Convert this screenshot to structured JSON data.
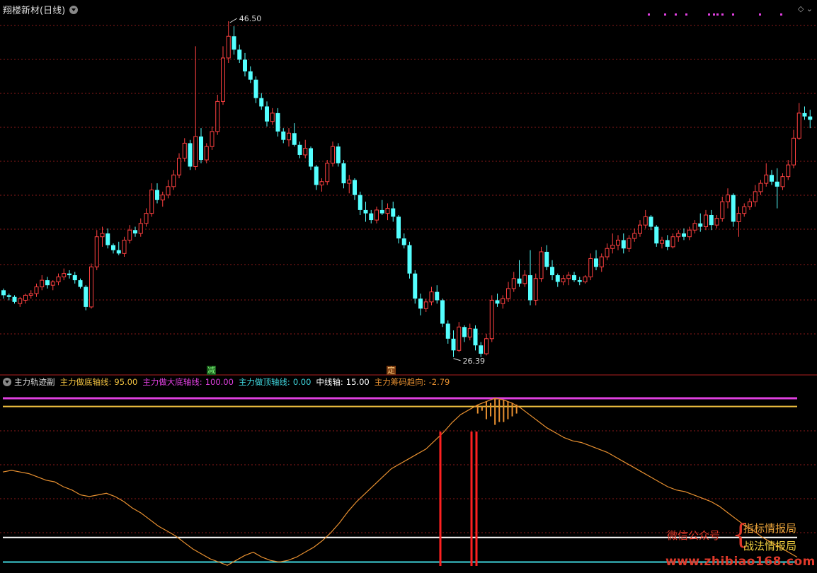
{
  "header": {
    "title": "翔楼新材(日线)"
  },
  "indicator": {
    "name": "主力轨迹副",
    "items": [
      {
        "label": "主力做底轴线:",
        "value": "95.00",
        "color": "#f0c040"
      },
      {
        "label": "主力做大底轴线:",
        "value": "100.00",
        "color": "#e040e0"
      },
      {
        "label": "主力做顶轴线:",
        "value": "0.00",
        "color": "#40d8e0"
      },
      {
        "label": "中线轴:",
        "value": "15.00",
        "color": "#ffffff"
      },
      {
        "label": "主力筹码趋向:",
        "value": "-2.79",
        "color": "#e89030"
      }
    ]
  },
  "markers": {
    "high_label": "46.50",
    "low_label": "26.39",
    "tag_reduce": "减",
    "tag_fix": "定"
  },
  "watermark": {
    "wechat": "微信公众号",
    "brace": "{",
    "brand1": "指标情报局",
    "brand2": "战法情报局",
    "url": "www.zhibiao168.com"
  },
  "colors": {
    "up": "#ff4040",
    "down": "#54ffff",
    "grid": "#8b1a1a",
    "magenta": "#e040e0",
    "gold": "#f0c040",
    "white": "#ffffff",
    "cyan": "#40d8e0",
    "orange": "#e89030",
    "red_bar": "#ff2020"
  },
  "chart_data": [
    {
      "type": "candlestick",
      "title": "翔楼新材(日线)",
      "ylim": [
        26.39,
        46.5
      ],
      "annotations": [
        {
          "label": "46.50",
          "kind": "high"
        },
        {
          "label": "26.39",
          "kind": "low"
        }
      ],
      "series": [
        {
          "values": [
            [
              30.4,
              30.5,
              29.9,
              30.1
            ],
            [
              30.1,
              30.2,
              29.8,
              30.0
            ],
            [
              30.0,
              30.1,
              29.6,
              29.7
            ],
            [
              29.6,
              30.0,
              29.4,
              29.9
            ],
            [
              29.8,
              30.2,
              29.6,
              30.1
            ],
            [
              30.1,
              30.4,
              29.9,
              30.2
            ],
            [
              30.2,
              30.8,
              30.0,
              30.6
            ],
            [
              30.6,
              31.3,
              30.4,
              31.0
            ],
            [
              31.0,
              31.2,
              30.5,
              30.7
            ],
            [
              30.7,
              31.0,
              30.4,
              30.9
            ],
            [
              30.9,
              31.4,
              30.7,
              31.2
            ],
            [
              31.2,
              31.7,
              31.0,
              31.4
            ],
            [
              31.4,
              31.6,
              31.1,
              31.3
            ],
            [
              31.3,
              31.5,
              30.8,
              31.0
            ],
            [
              31.0,
              31.1,
              30.5,
              30.6
            ],
            [
              30.6,
              30.7,
              29.2,
              29.4
            ],
            [
              29.4,
              32.0,
              29.3,
              31.8
            ],
            [
              31.8,
              34.0,
              31.6,
              33.6
            ],
            [
              33.6,
              34.2,
              33.0,
              33.8
            ],
            [
              33.8,
              34.1,
              32.9,
              33.1
            ],
            [
              33.1,
              33.2,
              32.6,
              32.8
            ],
            [
              32.8,
              33.3,
              32.5,
              32.6
            ],
            [
              32.6,
              33.6,
              32.4,
              33.4
            ],
            [
              33.4,
              34.3,
              33.2,
              34.0
            ],
            [
              34.0,
              34.2,
              33.6,
              33.8
            ],
            [
              33.8,
              34.7,
              33.6,
              34.4
            ],
            [
              34.4,
              35.3,
              34.2,
              35.0
            ],
            [
              35.0,
              36.8,
              34.8,
              36.4
            ],
            [
              36.4,
              36.8,
              35.6,
              35.8
            ],
            [
              35.8,
              36.3,
              35.4,
              36.1
            ],
            [
              36.1,
              37.0,
              35.9,
              36.6
            ],
            [
              36.6,
              37.6,
              36.4,
              37.3
            ],
            [
              37.3,
              38.6,
              37.1,
              38.3
            ],
            [
              38.3,
              39.5,
              38.1,
              39.2
            ],
            [
              39.2,
              39.4,
              37.6,
              37.8
            ],
            [
              37.8,
              45.0,
              37.6,
              39.6
            ],
            [
              39.6,
              40.1,
              38.0,
              38.2
            ],
            [
              38.2,
              39.2,
              38.0,
              39.0
            ],
            [
              39.0,
              40.2,
              38.8,
              39.9
            ],
            [
              39.9,
              42.1,
              39.7,
              41.7
            ],
            [
              41.7,
              45.0,
              41.5,
              44.3
            ],
            [
              44.3,
              46.5,
              44.0,
              45.6
            ],
            [
              45.6,
              46.2,
              44.5,
              44.8
            ],
            [
              44.8,
              45.1,
              44.0,
              44.2
            ],
            [
              44.2,
              44.6,
              43.2,
              43.5
            ],
            [
              43.5,
              43.8,
              42.8,
              43.0
            ],
            [
              43.0,
              43.2,
              41.6,
              41.9
            ],
            [
              41.9,
              42.2,
              41.2,
              41.4
            ],
            [
              41.4,
              41.7,
              40.2,
              40.5
            ],
            [
              40.5,
              41.3,
              40.3,
              41.0
            ],
            [
              41.0,
              41.3,
              39.6,
              39.9
            ],
            [
              39.9,
              40.1,
              39.2,
              39.4
            ],
            [
              39.4,
              40.1,
              39.0,
              39.8
            ],
            [
              39.8,
              40.4,
              39.0,
              39.1
            ],
            [
              39.1,
              39.3,
              38.3,
              38.5
            ],
            [
              38.5,
              39.4,
              38.3,
              38.9
            ],
            [
              38.9,
              39.0,
              37.6,
              37.8
            ],
            [
              37.8,
              37.9,
              36.4,
              36.7
            ],
            [
              36.7,
              37.1,
              36.3,
              36.9
            ],
            [
              36.9,
              38.2,
              36.7,
              38.0
            ],
            [
              38.0,
              39.3,
              37.8,
              39.0
            ],
            [
              39.0,
              39.2,
              37.8,
              38.0
            ],
            [
              38.0,
              38.2,
              36.5,
              36.8
            ],
            [
              36.8,
              37.3,
              36.2,
              37.0
            ],
            [
              37.0,
              37.1,
              35.8,
              36.1
            ],
            [
              36.1,
              36.3,
              34.9,
              35.2
            ],
            [
              35.2,
              35.7,
              34.5,
              35.0
            ],
            [
              35.0,
              35.2,
              34.4,
              34.6
            ],
            [
              34.6,
              35.4,
              34.4,
              35.2
            ],
            [
              35.2,
              35.8,
              34.9,
              35.0
            ],
            [
              35.0,
              35.6,
              34.6,
              35.3
            ],
            [
              35.3,
              35.7,
              34.5,
              34.8
            ],
            [
              34.8,
              34.9,
              33.2,
              33.5
            ],
            [
              33.5,
              33.8,
              32.9,
              33.1
            ],
            [
              33.1,
              33.3,
              31.1,
              31.4
            ],
            [
              31.4,
              31.6,
              29.6,
              29.9
            ],
            [
              29.9,
              30.2,
              28.9,
              29.3
            ],
            [
              29.3,
              29.9,
              29.1,
              29.7
            ],
            [
              29.7,
              30.6,
              29.5,
              30.3
            ],
            [
              30.3,
              30.7,
              29.6,
              29.8
            ],
            [
              29.8,
              29.9,
              28.2,
              28.4
            ],
            [
              28.4,
              28.6,
              27.2,
              27.5
            ],
            [
              27.5,
              28.0,
              26.4,
              26.8
            ],
            [
              26.8,
              28.5,
              26.7,
              28.2
            ],
            [
              28.2,
              28.3,
              27.3,
              27.6
            ],
            [
              27.6,
              28.4,
              27.4,
              28.1
            ],
            [
              28.1,
              28.3,
              26.8,
              27.1
            ],
            [
              27.1,
              27.3,
              26.4,
              26.6
            ],
            [
              26.6,
              27.8,
              26.5,
              27.5
            ],
            [
              27.5,
              30.1,
              27.3,
              29.8
            ],
            [
              29.8,
              30.2,
              29.4,
              29.6
            ],
            [
              29.6,
              30.1,
              29.3,
              29.9
            ],
            [
              29.9,
              30.9,
              29.7,
              30.5
            ],
            [
              30.5,
              31.5,
              30.3,
              31.1
            ],
            [
              31.1,
              32.2,
              30.6,
              30.8
            ],
            [
              30.8,
              31.6,
              30.6,
              31.3
            ],
            [
              31.3,
              32.8,
              29.5,
              29.8
            ],
            [
              29.8,
              31.4,
              29.5,
              31.1
            ],
            [
              31.1,
              33.0,
              30.9,
              32.7
            ],
            [
              32.7,
              33.1,
              31.6,
              31.8
            ],
            [
              31.8,
              32.2,
              31.0,
              31.3
            ],
            [
              31.3,
              31.4,
              30.6,
              30.9
            ],
            [
              30.9,
              31.3,
              30.7,
              31.1
            ],
            [
              31.1,
              31.5,
              30.7,
              31.3
            ],
            [
              31.3,
              31.5,
              30.9,
              31.0
            ],
            [
              31.0,
              31.2,
              30.7,
              30.9
            ],
            [
              30.9,
              31.3,
              30.8,
              31.2
            ],
            [
              31.2,
              32.6,
              31.0,
              32.3
            ],
            [
              32.3,
              32.8,
              31.6,
              31.8
            ],
            [
              31.8,
              32.6,
              31.5,
              32.4
            ],
            [
              32.4,
              33.2,
              32.2,
              32.9
            ],
            [
              32.9,
              33.8,
              32.6,
              33.1
            ],
            [
              33.1,
              33.7,
              32.8,
              33.4
            ],
            [
              33.4,
              33.8,
              32.6,
              32.9
            ],
            [
              32.9,
              33.7,
              32.7,
              33.5
            ],
            [
              33.5,
              34.1,
              33.3,
              33.8
            ],
            [
              33.8,
              34.6,
              33.6,
              34.3
            ],
            [
              34.3,
              35.2,
              34.1,
              34.8
            ],
            [
              34.8,
              34.9,
              34.0,
              34.2
            ],
            [
              34.2,
              34.3,
              33.0,
              33.2
            ],
            [
              33.2,
              33.6,
              32.9,
              33.4
            ],
            [
              33.4,
              33.7,
              32.8,
              33.0
            ],
            [
              33.0,
              33.8,
              32.9,
              33.6
            ],
            [
              33.6,
              34.0,
              33.3,
              33.8
            ],
            [
              33.8,
              34.1,
              33.4,
              33.6
            ],
            [
              33.6,
              34.2,
              33.4,
              34.0
            ],
            [
              34.0,
              34.6,
              33.8,
              34.4
            ],
            [
              34.4,
              35.0,
              33.9,
              34.2
            ],
            [
              34.2,
              35.2,
              34.0,
              34.9
            ],
            [
              34.9,
              35.2,
              34.0,
              34.3
            ],
            [
              34.3,
              34.9,
              34.1,
              34.7
            ],
            [
              34.7,
              36.0,
              34.5,
              35.7
            ],
            [
              35.7,
              36.5,
              35.3,
              36.1
            ],
            [
              36.1,
              36.2,
              34.2,
              34.5
            ],
            [
              34.5,
              35.4,
              33.6,
              35.0
            ],
            [
              35.0,
              35.6,
              34.8,
              35.4
            ],
            [
              35.4,
              35.9,
              35.2,
              35.7
            ],
            [
              35.7,
              36.7,
              35.4,
              36.3
            ],
            [
              36.3,
              37.0,
              36.1,
              36.8
            ],
            [
              36.8,
              38.0,
              36.6,
              37.3
            ],
            [
              37.3,
              37.6,
              36.7,
              36.9
            ],
            [
              36.9,
              37.7,
              35.3,
              36.6
            ],
            [
              36.6,
              37.4,
              36.4,
              37.2
            ],
            [
              37.2,
              38.2,
              37.0,
              37.9
            ],
            [
              37.9,
              40.0,
              37.7,
              39.5
            ],
            [
              39.5,
              41.6,
              39.4,
              41.0
            ],
            [
              41.0,
              41.4,
              40.6,
              40.8
            ],
            [
              40.8,
              41.2,
              40.1,
              40.6
            ]
          ]
        }
      ]
    },
    {
      "type": "line",
      "title": "主力轨迹副",
      "ylim": [
        -2.79,
        100
      ],
      "series": [
        {
          "name": "主力做底轴线",
          "values": [
            95,
            95
          ]
        },
        {
          "name": "主力做大底轴线",
          "values": [
            100,
            100
          ]
        },
        {
          "name": "主力做顶轴线",
          "values": [
            0,
            0
          ]
        },
        {
          "name": "中线轴",
          "values": [
            15,
            15
          ]
        },
        {
          "name": "主力筹码趋向",
          "values": [
            55,
            56,
            55,
            54,
            52,
            50,
            49,
            46,
            44,
            41,
            40,
            41,
            42,
            40,
            37,
            33,
            30,
            26,
            22,
            19,
            16,
            12,
            8,
            5,
            2,
            0,
            -2,
            1,
            4,
            6,
            3,
            1,
            0,
            1,
            3,
            6,
            9,
            13,
            18,
            24,
            31,
            37,
            42,
            47,
            52,
            57,
            60,
            63,
            66,
            69,
            74,
            79,
            85,
            90,
            93,
            96,
            98,
            100,
            99,
            97,
            94,
            90,
            86,
            82,
            79,
            76,
            74,
            73,
            71,
            69,
            67,
            64,
            61,
            58,
            55,
            52,
            49,
            46,
            44,
            43,
            41,
            39,
            37,
            34,
            30,
            26,
            22,
            19,
            15,
            12,
            9,
            6,
            3
          ]
        },
        {
          "name": "红色信号柱",
          "values": [
            1,
            1,
            1
          ]
        }
      ]
    }
  ]
}
